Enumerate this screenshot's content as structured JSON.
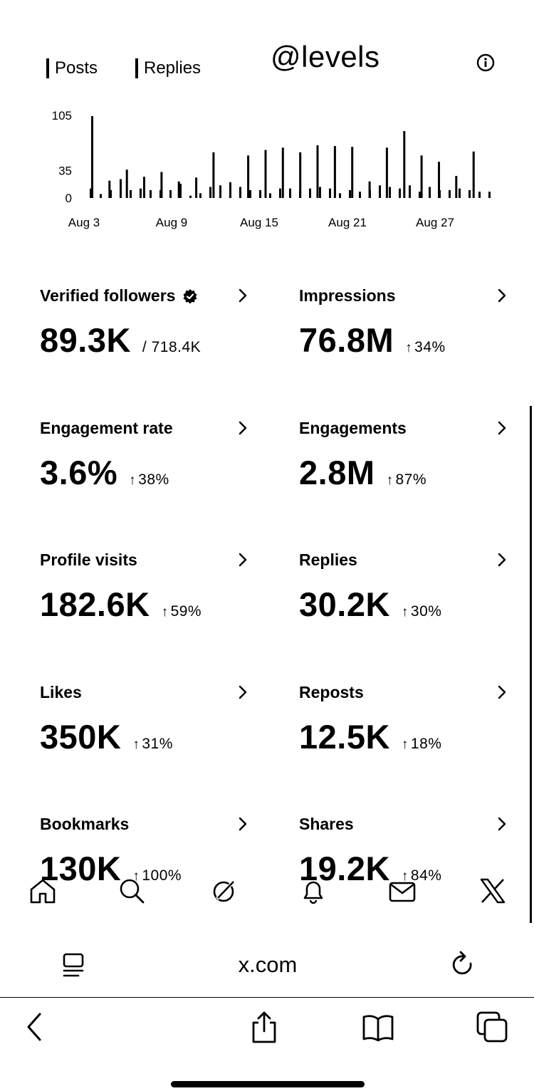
{
  "header": {
    "legend": {
      "posts_label": "Posts",
      "replies_label": "Replies"
    },
    "handle": "@levels",
    "info_icon": "info-icon"
  },
  "chart_data": {
    "type": "bar",
    "title": "",
    "xlabel": "",
    "ylabel": "",
    "ylim": [
      0,
      105
    ],
    "y_ticks": [
      "105",
      "35",
      "0"
    ],
    "x_tick_labels": [
      "Aug 3",
      "Aug 9",
      "Aug 15",
      "Aug 21",
      "Aug 27"
    ],
    "grid": false,
    "legend": "top-left",
    "series": [
      {
        "name": "Posts",
        "values": [
          104,
          22,
          36,
          27,
          33,
          21,
          26,
          58,
          0,
          54,
          61,
          64,
          58,
          67,
          66,
          65,
          21,
          64,
          85,
          54,
          46,
          28,
          59,
          0
        ]
      },
      {
        "name": "Replies",
        "values": [
          12,
          5,
          10,
          24,
          10,
          12,
          10,
          10,
          10,
          18,
          3,
          6,
          14,
          16,
          20,
          14,
          10,
          10,
          6,
          12,
          12,
          10,
          12,
          14,
          12,
          6,
          10,
          8,
          10,
          16,
          14,
          12,
          16,
          8,
          14,
          10,
          10,
          12,
          10,
          8,
          8
        ]
      }
    ]
  },
  "metrics": [
    {
      "label": "Verified followers",
      "value": "89.3K",
      "sub": "/ 718.4K",
      "arrow": "",
      "verified_icon": true
    },
    {
      "label": "Impressions",
      "value": "76.8M",
      "sub": "34%",
      "arrow": "↑"
    },
    {
      "label": "Engagement rate",
      "value": "3.6%",
      "sub": "38%",
      "arrow": "↑"
    },
    {
      "label": "Engagements",
      "value": "2.8M",
      "sub": "87%",
      "arrow": "↑"
    },
    {
      "label": "Profile visits",
      "value": "182.6K",
      "sub": "59%",
      "arrow": "↑"
    },
    {
      "label": "Replies",
      "value": "30.2K",
      "sub": "30%",
      "arrow": "↑"
    },
    {
      "label": "Likes",
      "value": "350K",
      "sub": "31%",
      "arrow": "↑"
    },
    {
      "label": "Reposts",
      "value": "12.5K",
      "sub": "18%",
      "arrow": "↑"
    },
    {
      "label": "Bookmarks",
      "value": "130K",
      "sub": "100%",
      "arrow": "↑"
    },
    {
      "label": "Shares",
      "value": "19.2K",
      "sub": "84%",
      "arrow": "↑"
    }
  ],
  "tabbar": [
    "home-icon",
    "search-icon",
    "grok-icon",
    "notifications-bell-icon",
    "messages-envelope-icon",
    "x-logo-icon"
  ],
  "browser": {
    "url": "x.com",
    "reader_icon": "reader-mode-icon",
    "reload_icon": "reload-icon",
    "toolbar": [
      "back-icon",
      "share-icon",
      "bookmarks-book-icon",
      "tabs-icon"
    ]
  }
}
